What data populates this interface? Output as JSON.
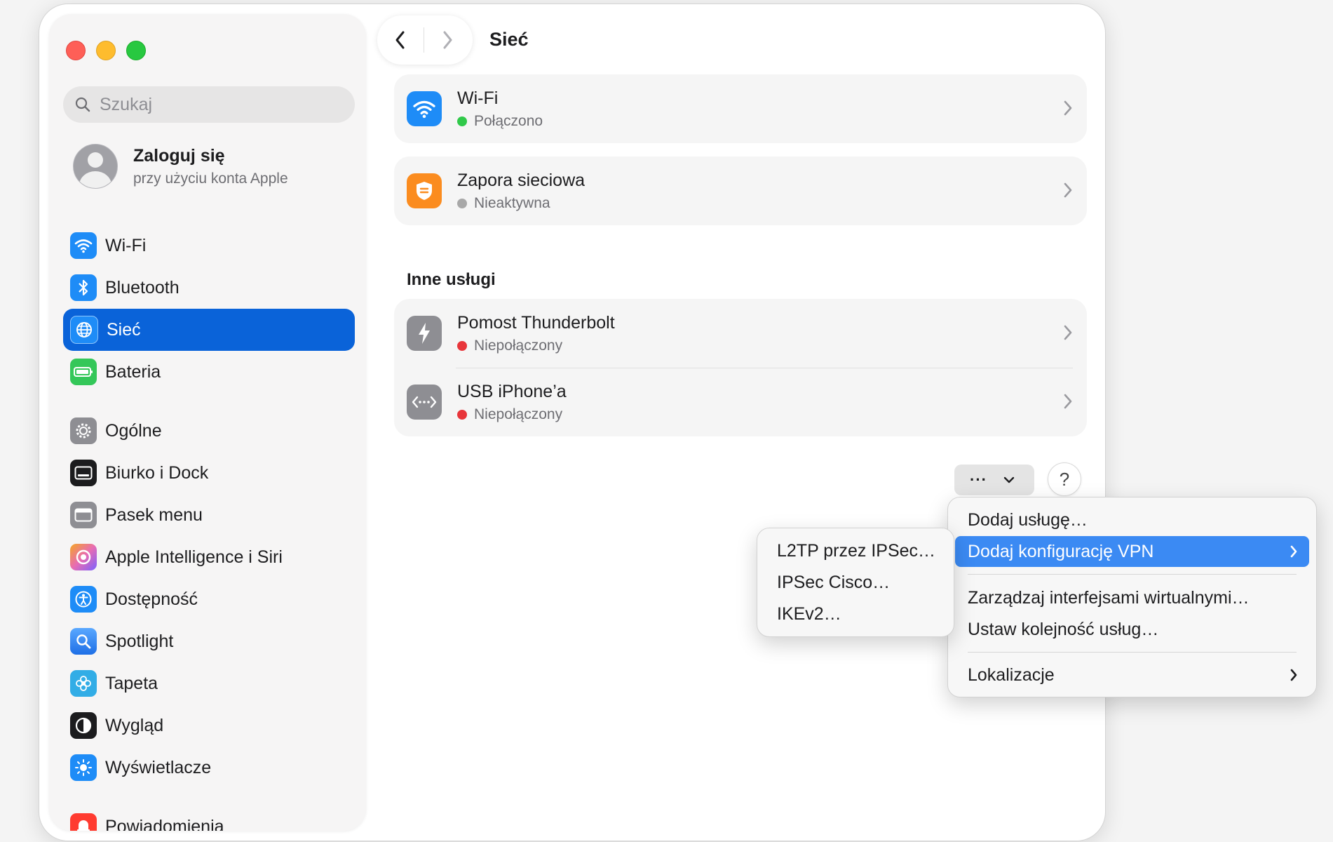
{
  "sidebar": {
    "search_placeholder": "Szukaj",
    "account": {
      "title": "Zaloguj się",
      "subtitle": "przy użyciu konta Apple"
    },
    "items": [
      {
        "label": "Wi-Fi",
        "icon": "wifi-icon",
        "color": "#1e8cf7"
      },
      {
        "label": "Bluetooth",
        "icon": "bluetooth-icon",
        "color": "#1e8cf7"
      },
      {
        "label": "Sieć",
        "icon": "globe-icon",
        "color": "#1e8cf7",
        "active": true
      },
      {
        "label": "Bateria",
        "icon": "battery-icon",
        "color": "#34c759"
      },
      {
        "label": "Ogólne",
        "icon": "gear-icon",
        "color": "#8e8e93"
      },
      {
        "label": "Biurko i Dock",
        "icon": "dock-icon",
        "color": "#1c1c1e"
      },
      {
        "label": "Pasek menu",
        "icon": "menubar-icon",
        "color": "#8e8e93"
      },
      {
        "label": "Apple Intelligence i Siri",
        "icon": "siri-icon",
        "color": "#e86cb3"
      },
      {
        "label": "Dostępność",
        "icon": "accessibility-icon",
        "color": "#1e8cf7"
      },
      {
        "label": "Spotlight",
        "icon": "spotlight-icon",
        "color": "#3a8cf0"
      },
      {
        "label": "Tapeta",
        "icon": "wallpaper-flower-icon",
        "color": "#32ade6"
      },
      {
        "label": "Wygląd",
        "icon": "appearance-icon",
        "color": "#1c1c1e"
      },
      {
        "label": "Wyświetlacze",
        "icon": "display-brightness-icon",
        "color": "#1e8cf7"
      },
      {
        "label": "Powiadomienia",
        "icon": "notifications-bell-icon",
        "color": "#ff3b30"
      }
    ]
  },
  "header": {
    "title": "Sieć"
  },
  "services": [
    {
      "title": "Wi-Fi",
      "status": "Połączono",
      "status_color": "#30c94a",
      "icon": "wifi-icon",
      "icon_color": "#1e8cf7"
    },
    {
      "title": "Zapora sieciowa",
      "status": "Nieaktywna",
      "status_color": "#a8a8a8",
      "icon": "firewall-shield-icon",
      "icon_color": "#fb8c1f"
    }
  ],
  "other_services": {
    "title": "Inne usługi",
    "items": [
      {
        "title": "Pomost Thunderbolt",
        "status": "Niepołączony",
        "status_color": "#e8353a",
        "icon": "thunderbolt-icon",
        "icon_color": "#8e8e93"
      },
      {
        "title": "USB iPhone’a",
        "status": "Niepołączony",
        "status_color": "#e8353a",
        "icon": "usb-arrows-icon",
        "icon_color": "#8e8e93"
      }
    ]
  },
  "actions": {
    "more_label": "···",
    "help_label": "?"
  },
  "main_menu": {
    "items": [
      {
        "label": "Dodaj usługę…"
      },
      {
        "label": "Dodaj konfigurację VPN",
        "highlighted": true,
        "has_submenu": true
      },
      {
        "label": "Zarządzaj interfejsami wirtualnymi…"
      },
      {
        "label": "Ustaw kolejność usług…"
      },
      {
        "label": "Lokalizacje",
        "has_submenu": true
      }
    ]
  },
  "vpn_submenu": {
    "items": [
      {
        "label": "L2TP przez IPSec…"
      },
      {
        "label": "IPSec Cisco…"
      },
      {
        "label": "IKEv2…"
      }
    ]
  },
  "colors": {
    "accent": "#0a63d9",
    "menu_highlight": "#3b8af3"
  }
}
